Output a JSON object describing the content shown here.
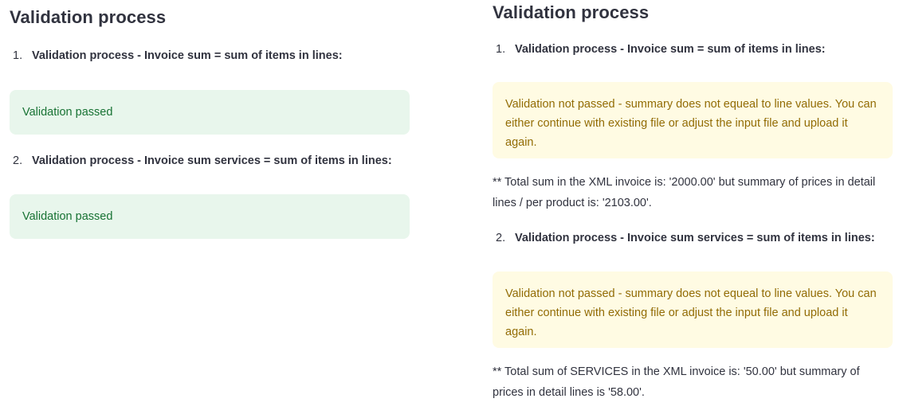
{
  "left": {
    "title": "Validation process",
    "steps": [
      {
        "number": "1.",
        "label": "Validation process - Invoice sum = sum of items in lines:",
        "result": "Validation passed"
      },
      {
        "number": "2.",
        "label": "Validation process - Invoice sum services = sum of items in lines:",
        "result": "Validation passed"
      }
    ]
  },
  "right": {
    "title": "Validation process",
    "steps": [
      {
        "number": "1.",
        "label": "Validation process - Invoice sum = sum of items in lines:",
        "result": "Validation not passed - summary does not equeal to line values. You can either continue with existing file or adjust the input file and upload it again.",
        "note": "** Total sum in the XML invoice is: '2000.00' but summary of prices in detail lines / per product is: '2103.00'."
      },
      {
        "number": "2.",
        "label": "Validation process - Invoice sum services = sum of items in lines:",
        "result": "Validation not passed - summary does not equeal to line values. You can either continue with existing file or adjust the input file and upload it again.",
        "note": "** Total sum of SERVICES in the XML invoice is: '50.00' but summary of prices in detail lines is '58.00'."
      }
    ]
  },
  "colors": {
    "success_bg": "#e8f6ec",
    "success_text": "#177233",
    "warning_bg": "#fffbe3",
    "warning_text": "#926c05",
    "body_text": "#31333f"
  }
}
